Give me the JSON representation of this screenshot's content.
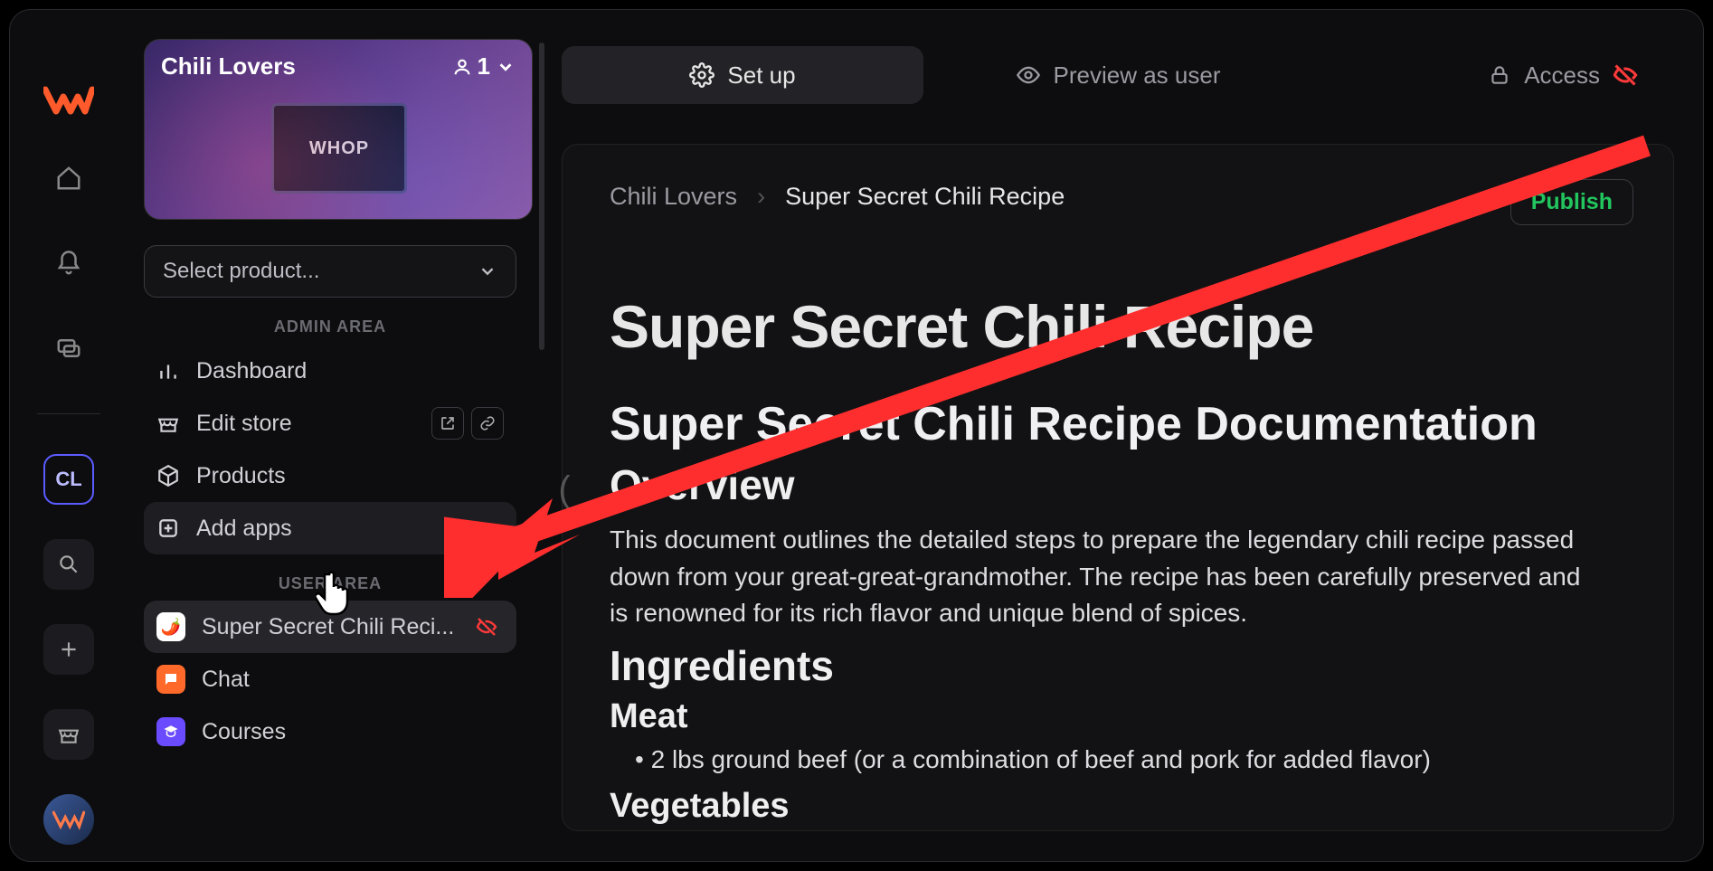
{
  "workspace": {
    "name": "Chili Lovers",
    "member_count": "1",
    "screen_text": "WHOP"
  },
  "rail": {
    "workspace_badge": "CL"
  },
  "sidebar": {
    "select_placeholder": "Select product...",
    "admin_label": "ADMIN AREA",
    "user_label": "USER AREA",
    "admin_items": [
      {
        "label": "Dashboard"
      },
      {
        "label": "Edit store"
      },
      {
        "label": "Products"
      },
      {
        "label": "Add apps"
      }
    ],
    "user_items": [
      {
        "label": "Super Secret Chili Reci..."
      },
      {
        "label": "Chat"
      },
      {
        "label": "Courses"
      }
    ]
  },
  "topbar": {
    "setup": "Set up",
    "preview": "Preview as user",
    "access": "Access"
  },
  "breadcrumbs": {
    "root": "Chili Lovers",
    "current": "Super Secret Chili Recipe"
  },
  "publish_label": "Publish",
  "document": {
    "title": "Super Secret Chili Recipe",
    "h2_doc": "Super Secret Chili Recipe Documentation",
    "h3_overview": "Overview",
    "overview_text": "This document outlines the detailed steps to prepare the legendary chili recipe passed down from your great-great-grandmother. The recipe has been carefully preserved and is renowned for its rich flavor and unique blend of spices.",
    "h3_ingredients": "Ingredients",
    "h4_meat": "Meat",
    "meat_li_1": "2 lbs ground beef (or a combination of beef and pork for added flavor)",
    "h4_vegetables": "Vegetables"
  }
}
